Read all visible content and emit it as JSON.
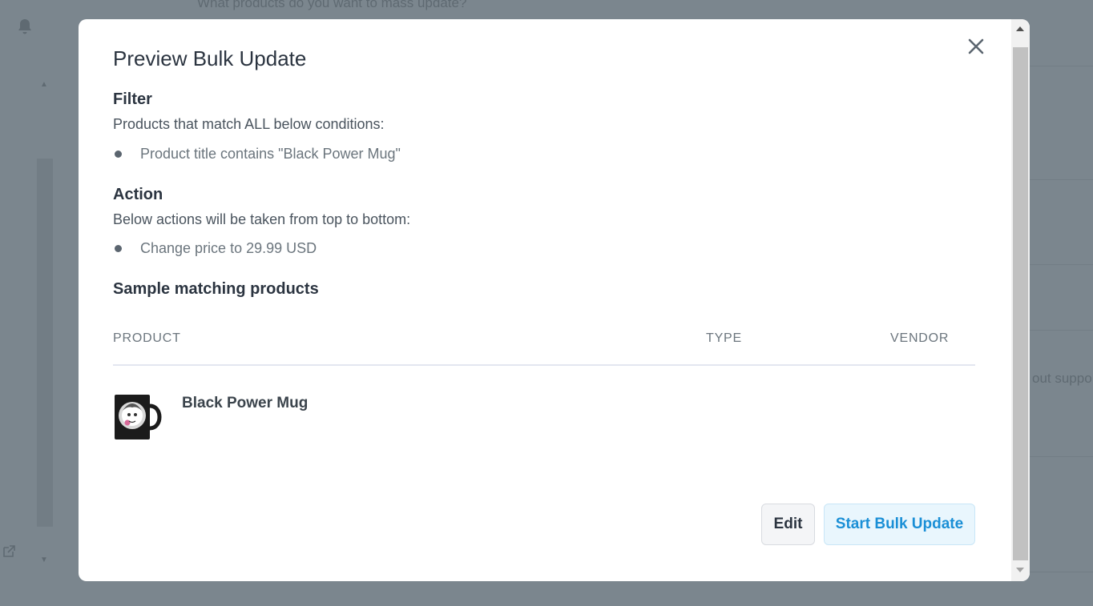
{
  "background": {
    "question_text": "What products do you want to mass update?",
    "right_text": "out suppo"
  },
  "modal": {
    "title": "Preview Bulk Update",
    "filter": {
      "heading": "Filter",
      "description": "Products that match ALL below conditions:",
      "conditions": [
        "Product title contains \"Black Power Mug\""
      ]
    },
    "action": {
      "heading": "Action",
      "description": "Below actions will be taken from top to bottom:",
      "actions": [
        "Change price to 29.99 USD"
      ]
    },
    "sample": {
      "heading": "Sample matching products",
      "columns": [
        "PRODUCT",
        "TYPE",
        "VENDOR"
      ],
      "rows": [
        {
          "name": "Black Power Mug",
          "type": "",
          "vendor": ""
        }
      ]
    },
    "buttons": {
      "edit": "Edit",
      "start": "Start Bulk Update"
    }
  },
  "colors": {
    "overlay": "#7b868e",
    "primary": "#1a8fd6",
    "primary_bg": "#e9f6fd"
  },
  "icons": [
    "close-icon",
    "bell-icon",
    "external-link-icon",
    "mug-thumbnail"
  ]
}
